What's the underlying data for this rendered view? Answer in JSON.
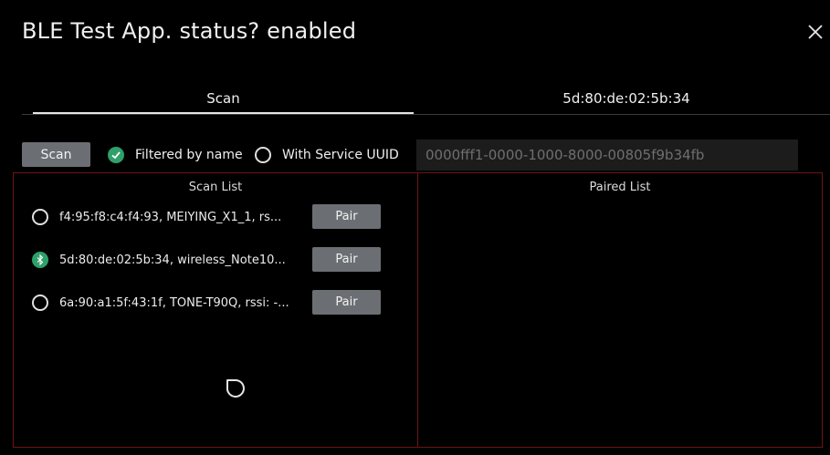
{
  "window": {
    "title": "BLE Test App. status? enabled"
  },
  "tabs": [
    {
      "label": "Scan",
      "active": true
    },
    {
      "label": "5d:80:de:02:5b:34",
      "active": false
    }
  ],
  "toolbar": {
    "scan_label": "Scan",
    "filtered_by_name_label": "Filtered by name",
    "filtered_by_name_checked": true,
    "service_uuid_label": "With Service UUID",
    "service_uuid_checked": false,
    "uuid_placeholder": "0000fff1-0000-1000-8000-00805f9b34fb"
  },
  "scan_list": {
    "title": "Scan List",
    "devices": [
      {
        "text": "f4:95:f8:c4:f4:93, MEIYING_X1_1, rs...",
        "pair_label": "Pair",
        "connected": false
      },
      {
        "text": "5d:80:de:02:5b:34, wireless_Note10...",
        "pair_label": "Pair",
        "connected": true
      },
      {
        "text": "6a:90:a1:5f:43:1f, TONE-T90Q, rssi: -...",
        "pair_label": "Pair",
        "connected": false
      }
    ]
  },
  "paired_list": {
    "title": "Paired List"
  },
  "colors": {
    "accent_green": "#2ea16a",
    "panel_border": "#6e1414",
    "button_bg": "#6b6f73"
  }
}
